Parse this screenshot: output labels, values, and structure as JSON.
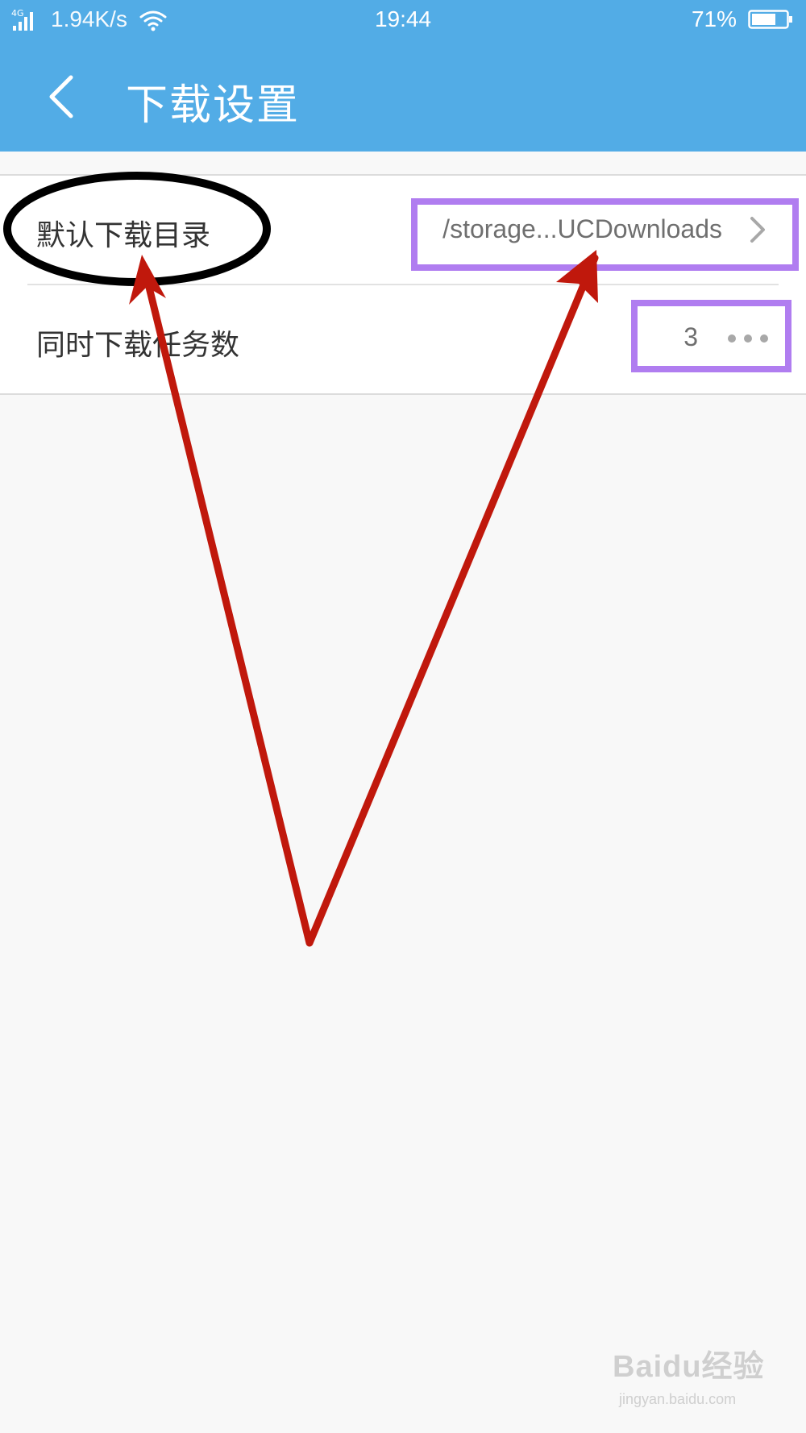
{
  "status_bar": {
    "network_type": "4G",
    "speed": "1.94K/s",
    "time": "19:44",
    "battery_percent": "71%",
    "battery_level": 0.71
  },
  "header": {
    "title": "下载设置",
    "back_icon": "chevron-left-icon",
    "background_color": "#52ace6"
  },
  "settings": {
    "items": [
      {
        "label": "默认下载目录",
        "value": "/storage...UCDownloads",
        "trailing_icon": "chevron-right-icon"
      },
      {
        "label": "同时下载任务数",
        "value": "3",
        "trailing_icon": "more-dots-icon"
      }
    ]
  },
  "annotations": {
    "ellipse_color": "#000000",
    "box_color": "#b07df0",
    "arrow_color": "#c0180c"
  },
  "watermark": {
    "logo": "Baidu经验",
    "sub": "jingyan.baidu.com"
  }
}
